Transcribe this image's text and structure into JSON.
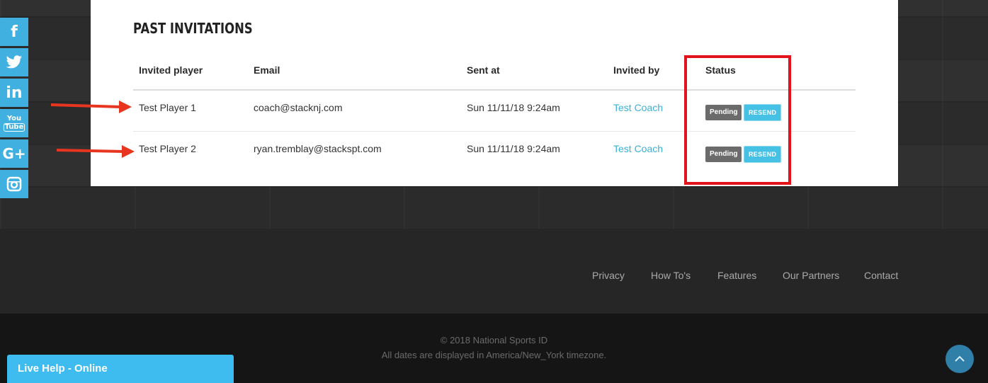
{
  "section": {
    "title": "PAST INVITATIONS"
  },
  "table": {
    "headers": [
      "Invited player",
      "Email",
      "Sent at",
      "Invited by",
      "Status"
    ],
    "rows": [
      {
        "player": "Test Player 1",
        "email": "coach@stacknj.com",
        "sent_at": "Sun 11/11/18 9:24am",
        "invited_by": "Test Coach",
        "status": "Pending",
        "action": "RESEND"
      },
      {
        "player": "Test Player 2",
        "email": "ryan.tremblay@stackspt.com",
        "sent_at": "Sun 11/11/18 9:24am",
        "invited_by": "Test Coach",
        "status": "Pending",
        "action": "RESEND"
      }
    ]
  },
  "social": {
    "icons": [
      "facebook-icon",
      "twitter-icon",
      "linkedin-icon",
      "youtube-icon",
      "google-plus-icon",
      "instagram-icon"
    ],
    "labels": [
      "f",
      "t",
      "in",
      "You Tube",
      "G+",
      "ig"
    ]
  },
  "footer": {
    "nav": [
      "Privacy",
      "How To's",
      "Features",
      "Our Partners",
      "Contact"
    ],
    "copyright": "© 2018 National Sports ID",
    "timezone_note": "All dates are displayed in America/New_York timezone."
  },
  "live_help": {
    "label": "Live Help - Online"
  },
  "colors": {
    "accent": "#3fb0e0",
    "highlight": "#e3131b",
    "arrow": "#e8351f",
    "pending": "#6b6b6b",
    "resend": "#45c1e6"
  }
}
